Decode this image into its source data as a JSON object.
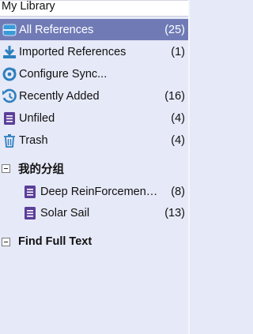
{
  "header": {
    "title": "My Library"
  },
  "items": [
    {
      "label": "All References",
      "count": "(25)"
    },
    {
      "label": "Imported References",
      "count": "(1)"
    },
    {
      "label": "Configure Sync...",
      "count": ""
    },
    {
      "label": "Recently Added",
      "count": "(16)"
    },
    {
      "label": "Unfiled",
      "count": "(4)"
    },
    {
      "label": "Trash",
      "count": "(4)"
    }
  ],
  "groups": [
    {
      "label": "我的分组",
      "items": [
        {
          "label": "Deep ReinForcement ...",
          "count": "(8)"
        },
        {
          "label": "Solar Sail",
          "count": "(13)"
        }
      ]
    },
    {
      "label": "Find Full Text",
      "items": []
    }
  ],
  "colors": {
    "selected_bg": "#707bb6",
    "panel_bg": "#e6e9f7",
    "icon_blue": "#2d7fbf",
    "icon_purple": "#5b3f9a"
  }
}
